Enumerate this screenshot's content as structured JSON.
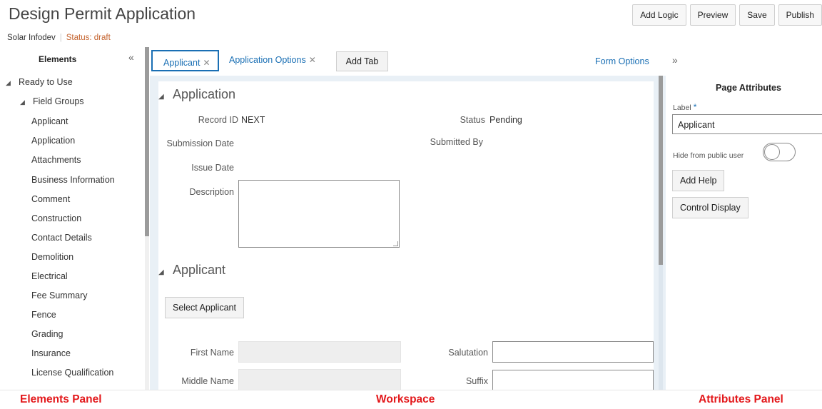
{
  "header": {
    "title": "Design Permit Application",
    "org": "Solar Infodev",
    "status": "Status: draft",
    "buttons": [
      "Add Logic",
      "Preview",
      "Save",
      "Publish"
    ]
  },
  "elements_panel": {
    "title": "Elements",
    "collapse_glyph": "«",
    "tree": {
      "root": "Ready to Use",
      "group": "Field Groups",
      "items": [
        "Applicant",
        "Application",
        "Attachments",
        "Business Information",
        "Comment",
        "Construction",
        "Contact Details",
        "Demolition",
        "Electrical",
        "Fee Summary",
        "Fence",
        "Grading",
        "Insurance",
        "License Qualification"
      ]
    }
  },
  "workspace": {
    "tabs": [
      {
        "label": "Applicant",
        "active": true
      },
      {
        "label": "Application Options",
        "active": false
      }
    ],
    "add_tab": "Add Tab",
    "form_options": "Form Options",
    "sections": {
      "application": {
        "title": "Application",
        "record_id_label": "Record ID",
        "record_id_value": "NEXT",
        "status_label": "Status",
        "status_value": "Pending",
        "submission_date_label": "Submission Date",
        "submitted_by_label": "Submitted By",
        "issue_date_label": "Issue Date",
        "description_label": "Description"
      },
      "applicant": {
        "title": "Applicant",
        "select_button": "Select Applicant",
        "first_name_label": "First Name",
        "middle_name_label": "Middle Name",
        "salutation_label": "Salutation",
        "suffix_label": "Suffix"
      }
    }
  },
  "attributes_panel": {
    "expand_glyph": "»",
    "title": "Page Attributes",
    "label_caption": "Label",
    "required_mark": "*",
    "label_value": "Applicant",
    "hide_label": "Hide from public user",
    "hide_from_public": false,
    "add_help": "Add Help",
    "control_display": "Control Display"
  },
  "annotations": {
    "elements": "Elements Panel",
    "workspace": "Workspace",
    "attributes": "Attributes Panel"
  },
  "colors": {
    "link": "#1a6fb4",
    "status_draft": "#c4622d",
    "annotation": "#e3181b"
  }
}
